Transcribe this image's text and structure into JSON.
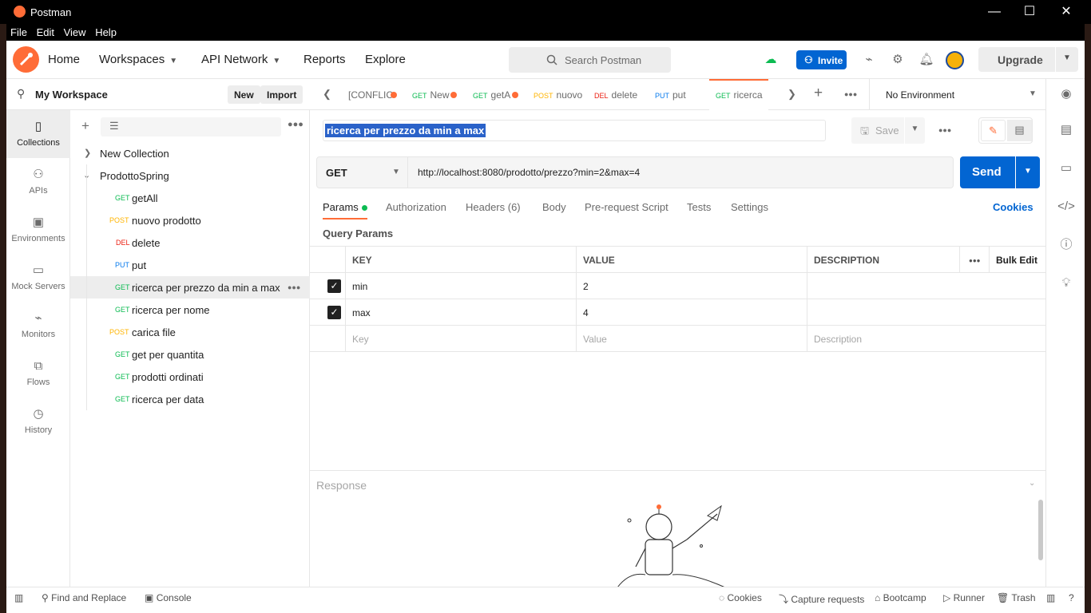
{
  "window": {
    "title": "Postman",
    "minimize": "—",
    "maximize": "☐",
    "close": "✕"
  },
  "menu": [
    "File",
    "Edit",
    "View",
    "Help"
  ],
  "header": {
    "nav": {
      "home": "Home",
      "workspaces": "Workspaces",
      "api_network": "API Network",
      "reports": "Reports",
      "explore": "Explore"
    },
    "search_placeholder": "Search Postman",
    "invite": "Invite",
    "upgrade": "Upgrade"
  },
  "workspace": {
    "name": "My Workspace",
    "new": "New",
    "import": "Import"
  },
  "iconbar": [
    {
      "label": "Collections",
      "icon": "collections-icon",
      "glyph": "▯"
    },
    {
      "label": "APIs",
      "icon": "apis-icon",
      "glyph": "⚇"
    },
    {
      "label": "Environments",
      "icon": "environments-icon",
      "glyph": "▣"
    },
    {
      "label": "Mock Servers",
      "icon": "mock-servers-icon",
      "glyph": "▭"
    },
    {
      "label": "Monitors",
      "icon": "monitors-icon",
      "glyph": "⌁"
    },
    {
      "label": "Flows",
      "icon": "flows-icon",
      "glyph": "⧉"
    },
    {
      "label": "History",
      "icon": "history-icon",
      "glyph": "◷"
    }
  ],
  "collections": {
    "new_collection": "New Collection",
    "project": "ProdottoSpring",
    "requests": [
      {
        "method": "GET",
        "name": "getAll"
      },
      {
        "method": "POST",
        "name": "nuovo prodotto"
      },
      {
        "method": "DEL",
        "name": "delete"
      },
      {
        "method": "PUT",
        "name": "put"
      },
      {
        "method": "GET",
        "name": "ricerca per prezzo da min a max"
      },
      {
        "method": "GET",
        "name": "ricerca per nome"
      },
      {
        "method": "POST",
        "name": "carica file"
      },
      {
        "method": "GET",
        "name": "get per quantita"
      },
      {
        "method": "GET",
        "name": "prodotti ordinati"
      },
      {
        "method": "GET",
        "name": "ricerca per data"
      }
    ]
  },
  "tabs": [
    {
      "method": "",
      "name": "[CONFLIC"
    },
    {
      "method": "GET",
      "name": "New"
    },
    {
      "method": "GET",
      "name": "getA"
    },
    {
      "method": "POST",
      "name": "nuovo"
    },
    {
      "method": "DEL",
      "name": "delete"
    },
    {
      "method": "PUT",
      "name": "put"
    },
    {
      "method": "GET",
      "name": "ricerca"
    }
  ],
  "environment": "No Environment",
  "request": {
    "title": "ricerca per prezzo da min a max",
    "save": "Save",
    "method": "GET",
    "url": "http://localhost:8080/prodotto/prezzo?min=2&max=4",
    "send": "Send"
  },
  "request_tabs": {
    "params": "Params",
    "authorization": "Authorization",
    "headers": "Headers (6)",
    "body": "Body",
    "pre_request": "Pre-request Script",
    "tests": "Tests",
    "settings": "Settings",
    "cookies": "Cookies"
  },
  "query_params": {
    "title": "Query Params",
    "headers": {
      "key": "KEY",
      "value": "VALUE",
      "description": "DESCRIPTION",
      "bulk_edit": "Bulk Edit"
    },
    "rows": [
      {
        "checked": true,
        "key": "min",
        "value": "2",
        "description": ""
      },
      {
        "checked": true,
        "key": "max",
        "value": "4",
        "description": ""
      }
    ],
    "placeholders": {
      "key": "Key",
      "value": "Value",
      "description": "Description"
    }
  },
  "response": {
    "title": "Response"
  },
  "statusbar": {
    "find_replace": "Find and Replace",
    "console": "Console",
    "cookies": "Cookies",
    "capture": "Capture requests",
    "bootcamp": "Bootcamp",
    "runner": "Runner",
    "trash": "Trash"
  },
  "colors": {
    "brand": "#ff6c37",
    "primary": "#0265d2",
    "get": "#0cbb52",
    "post": "#ffb400",
    "delete": "#eb2013",
    "put": "#097bed"
  }
}
